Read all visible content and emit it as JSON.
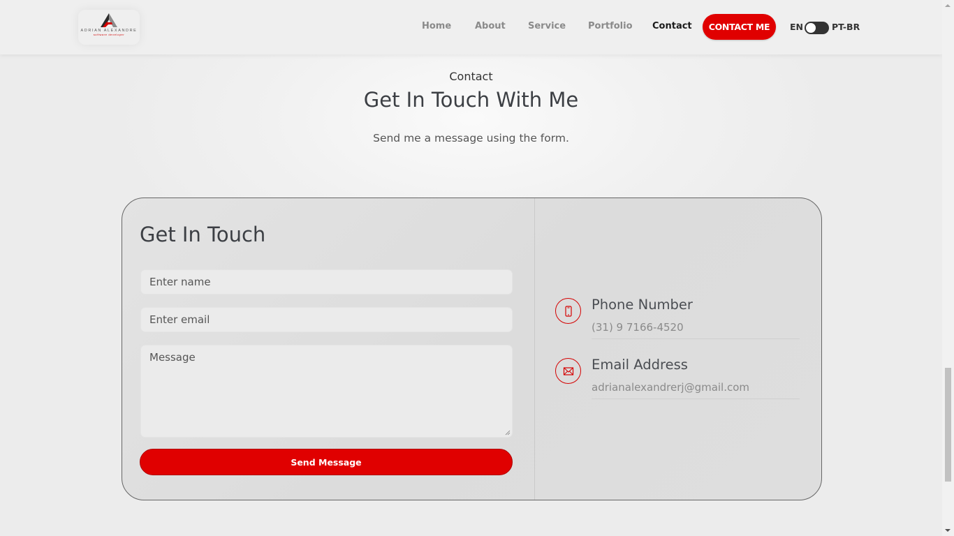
{
  "header": {
    "logo": {
      "name": "ADRIAN ALEXANDRE",
      "subtitle": "software developer"
    },
    "nav": [
      {
        "label": "Home"
      },
      {
        "label": "About"
      },
      {
        "label": "Service"
      },
      {
        "label": "Portfolio"
      },
      {
        "label": "Contact",
        "active": true
      }
    ],
    "cta_label": "CONTACT ME",
    "lang": {
      "left": "EN",
      "right": "PT-BR"
    }
  },
  "section": {
    "subtitle": "Contact",
    "title": "Get In Touch With Me",
    "description": "Send me a message using the form."
  },
  "form": {
    "title": "Get In Touch",
    "name_placeholder": "Enter name",
    "email_placeholder": "Enter email",
    "message_placeholder": "Message",
    "send_label": "Send Message"
  },
  "info": {
    "phone": {
      "label": "Phone Number",
      "value": "(31) 9 7166-4520",
      "icon": "smartphone-icon"
    },
    "email": {
      "label": "Email Address",
      "value": "adrianalexandrerj@gmail.com",
      "icon": "envelope-icon"
    }
  },
  "colors": {
    "accent": "#e00000",
    "text_dark": "#3c3f44",
    "background": "#efefef"
  }
}
